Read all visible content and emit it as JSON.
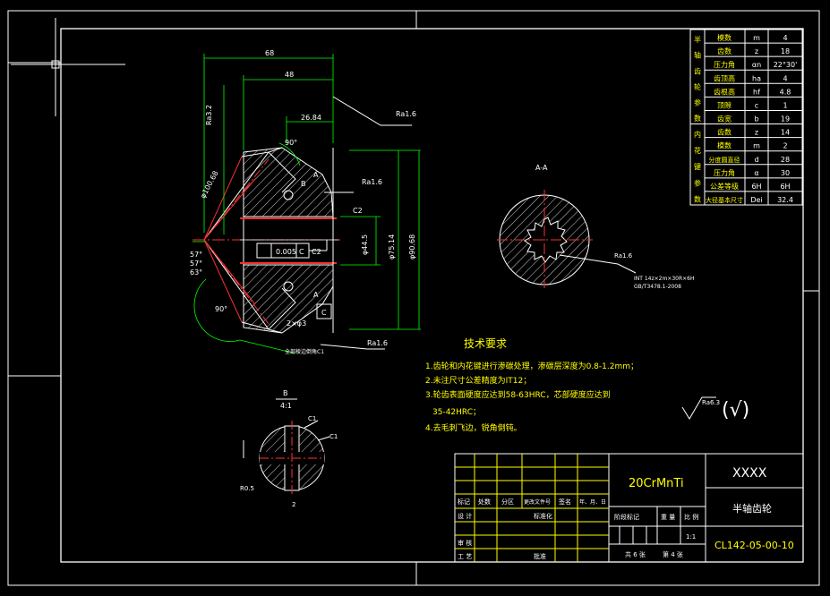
{
  "params_table": {
    "gear_group": "半轴齿轮参数",
    "spline_group": "内花键参数",
    "rows": [
      {
        "name": "模数",
        "sym": "m",
        "val": "4"
      },
      {
        "name": "齿数",
        "sym": "z",
        "val": "18"
      },
      {
        "name": "压力角",
        "sym": "αn",
        "val": "22°30'"
      },
      {
        "name": "齿顶高",
        "sym": "ha",
        "val": "4"
      },
      {
        "name": "齿根高",
        "sym": "hf",
        "val": "4.8"
      },
      {
        "name": "顶隙",
        "sym": "c",
        "val": "1"
      },
      {
        "name": "齿宽",
        "sym": "b",
        "val": "19"
      },
      {
        "name": "齿数",
        "sym": "z",
        "val": "14"
      },
      {
        "name": "模数",
        "sym": "m",
        "val": "2"
      },
      {
        "name": "分度圆直径",
        "sym": "d",
        "val": "28"
      },
      {
        "name": "压力角",
        "sym": "α",
        "val": "30"
      },
      {
        "name": "公差等级",
        "sym": "6H",
        "val": "6H"
      },
      {
        "name": "大径基本尺寸",
        "sym": "Dei",
        "val": "32.4"
      }
    ]
  },
  "tech": {
    "title": "技术要求",
    "lines": [
      "1.齿轮和内花键进行渗碳处理，渗碳层深度为0.8-1.2mm；",
      "2.未注尺寸公差精度为IT12；",
      "3.轮齿表面硬度应达到58-63HRC，芯部硬度应达到",
      "35-42HRC；",
      "4.去毛刺飞边，锐角倒钝。"
    ]
  },
  "section_label": "A-A",
  "detail_label": {
    "name": "B",
    "scale": "4:1"
  },
  "roughness_note": "Ra6.3",
  "spline_note": {
    "line1": "INT 14z×2m×30R×6H",
    "line2": "GB/T3478.1-2008"
  },
  "dims": {
    "d68": "68",
    "d48": "48",
    "d26": "26.84",
    "ang90a": "90°",
    "ang90b": "90°",
    "ang57a": "57°",
    "ang57b": "57°",
    "ang63": "63°",
    "ra32": "Ra3.2",
    "ra16a": "Ra1.6",
    "ra16b": "Ra1.6",
    "ra16c": "Ra1.6",
    "ra16d": "Ra1.6",
    "phi_a": "φ44.5",
    "phi_b": "φ75.14",
    "phi_c": "φ90.68",
    "cone": "φ100.68",
    "c2a": "C2",
    "c2b": "C2",
    "tol": "0.005",
    "tol_ref": "C",
    "c_box": "C",
    "b_mark": "B",
    "a_top": "A",
    "a_bot": "A",
    "fillet": "2×φ3",
    "note_bottom": "全部棱边倒角C1",
    "c1a": "C1",
    "c1b": "C1",
    "r05": "R0.5",
    "d2": "2",
    "spline_ra": "Ra1.6"
  },
  "title_block": {
    "material": "20CrMnTi",
    "company": "XXXX",
    "part_name": "半轴齿轮",
    "drawing_no": "CL142-05-00-10",
    "scale": "1:1",
    "h_mark": "标记",
    "h_count": "处数",
    "h_zone": "分区",
    "h_docno": "更改文件号",
    "h_sign": "签名",
    "h_date": "年、月、日",
    "h_design": "设 计",
    "h_std": "标准化",
    "h_stage": "阶段标记",
    "h_weight": "重 量",
    "h_scale": "比 例",
    "h_review": "审 核",
    "h_process": "工 艺",
    "h_approve": "批准",
    "sheets": "共 6 张",
    "sheet": "第 4 张"
  }
}
